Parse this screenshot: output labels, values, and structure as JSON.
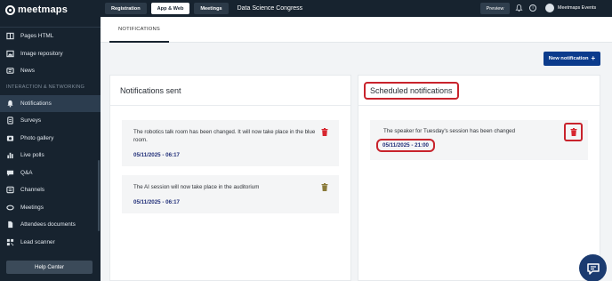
{
  "brand": {
    "name": "meetmaps"
  },
  "sidebar": {
    "items_top": [
      {
        "label": "Pages HTML",
        "icon": "pages-icon"
      },
      {
        "label": "Image repository",
        "icon": "image-icon"
      },
      {
        "label": "News",
        "icon": "news-icon"
      }
    ],
    "section_label": "INTERACTION & NETWORKING",
    "items": [
      {
        "label": "Notifications",
        "icon": "bell-icon",
        "active": true
      },
      {
        "label": "Surveys",
        "icon": "survey-icon"
      },
      {
        "label": "Photo gallery",
        "icon": "photo-icon"
      },
      {
        "label": "Live polls",
        "icon": "poll-icon"
      },
      {
        "label": "Q&A",
        "icon": "qa-icon"
      },
      {
        "label": "Channels",
        "icon": "channels-icon"
      },
      {
        "label": "Meetings",
        "icon": "meetings-icon"
      },
      {
        "label": "Attendees documents",
        "icon": "documents-icon"
      },
      {
        "label": "Lead scanner",
        "icon": "scanner-icon"
      }
    ],
    "help_label": "Help Center"
  },
  "topbar": {
    "tabs": [
      {
        "label": "Registration",
        "selected": false
      },
      {
        "label": "App & Web",
        "selected": true
      },
      {
        "label": "Meetings",
        "selected": false
      }
    ],
    "event_title": "Data Science Congress",
    "preview_label": "Preview",
    "user_name": "Meetmaps Events"
  },
  "subheader": {
    "tab_label": "NOTIFICATIONS"
  },
  "new_notification_label": "New notification",
  "sent_panel": {
    "title": "Notifications sent",
    "items": [
      {
        "text": "The robotics talk room has been changed. It will now take place in the blue room.",
        "date": "05/11/2025 - 06:17"
      },
      {
        "text": "The AI session will now take place in the auditorium",
        "date": "05/11/2025 - 06:17"
      }
    ]
  },
  "scheduled_panel": {
    "title": "Scheduled notifications",
    "items": [
      {
        "text": "The speaker for Tuesday's session has been changed",
        "date": "05/11/2025 - 21:00"
      }
    ]
  },
  "colors": {
    "sidebar_bg": "#17232f",
    "primary_button": "#0b3b8c",
    "date_text": "#23317a",
    "delete_icon": "#d7262f",
    "highlight_outline": "#c8232c"
  }
}
